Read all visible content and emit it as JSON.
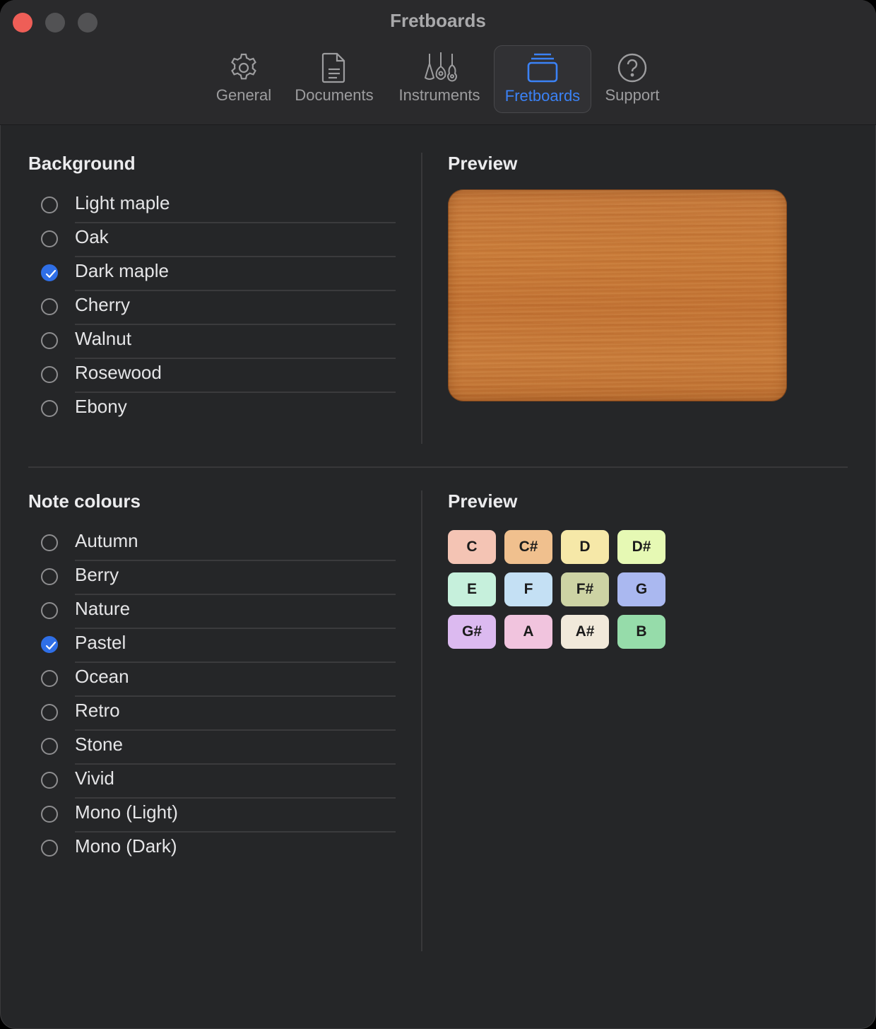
{
  "window": {
    "title": "Fretboards"
  },
  "toolbar": {
    "items": [
      {
        "label": "General",
        "icon": "gear-icon"
      },
      {
        "label": "Documents",
        "icon": "document-icon"
      },
      {
        "label": "Instruments",
        "icon": "instruments-icon"
      },
      {
        "label": "Fretboards",
        "icon": "fretboards-icon",
        "active": true
      },
      {
        "label": "Support",
        "icon": "question-circle-icon"
      }
    ]
  },
  "background": {
    "title": "Background",
    "options": [
      "Light maple",
      "Oak",
      "Dark maple",
      "Cherry",
      "Walnut",
      "Rosewood",
      "Ebony"
    ],
    "selected": "Dark maple",
    "preview_title": "Preview"
  },
  "note_colours": {
    "title": "Note colours",
    "options": [
      "Autumn",
      "Berry",
      "Nature",
      "Pastel",
      "Ocean",
      "Retro",
      "Stone",
      "Vivid",
      "Mono (Light)",
      "Mono (Dark)"
    ],
    "selected": "Pastel",
    "preview_title": "Preview",
    "notes": [
      {
        "name": "C",
        "color": "#f4c4b4"
      },
      {
        "name": "C#",
        "color": "#f0c08e"
      },
      {
        "name": "D",
        "color": "#f6e8a8"
      },
      {
        "name": "D#",
        "color": "#e6f9b4"
      },
      {
        "name": "E",
        "color": "#c6f0dc"
      },
      {
        "name": "F",
        "color": "#c4e0f4"
      },
      {
        "name": "F#",
        "color": "#cdd3a4"
      },
      {
        "name": "G",
        "color": "#aab8f0"
      },
      {
        "name": "G#",
        "color": "#dcbaf0"
      },
      {
        "name": "A",
        "color": "#f1c4de"
      },
      {
        "name": "A#",
        "color": "#f1e9da"
      },
      {
        "name": "B",
        "color": "#96dcaa"
      }
    ]
  },
  "colors": {
    "accent": "#2f6fe7",
    "close": "#ee5e57",
    "window_bg": "#252628"
  }
}
